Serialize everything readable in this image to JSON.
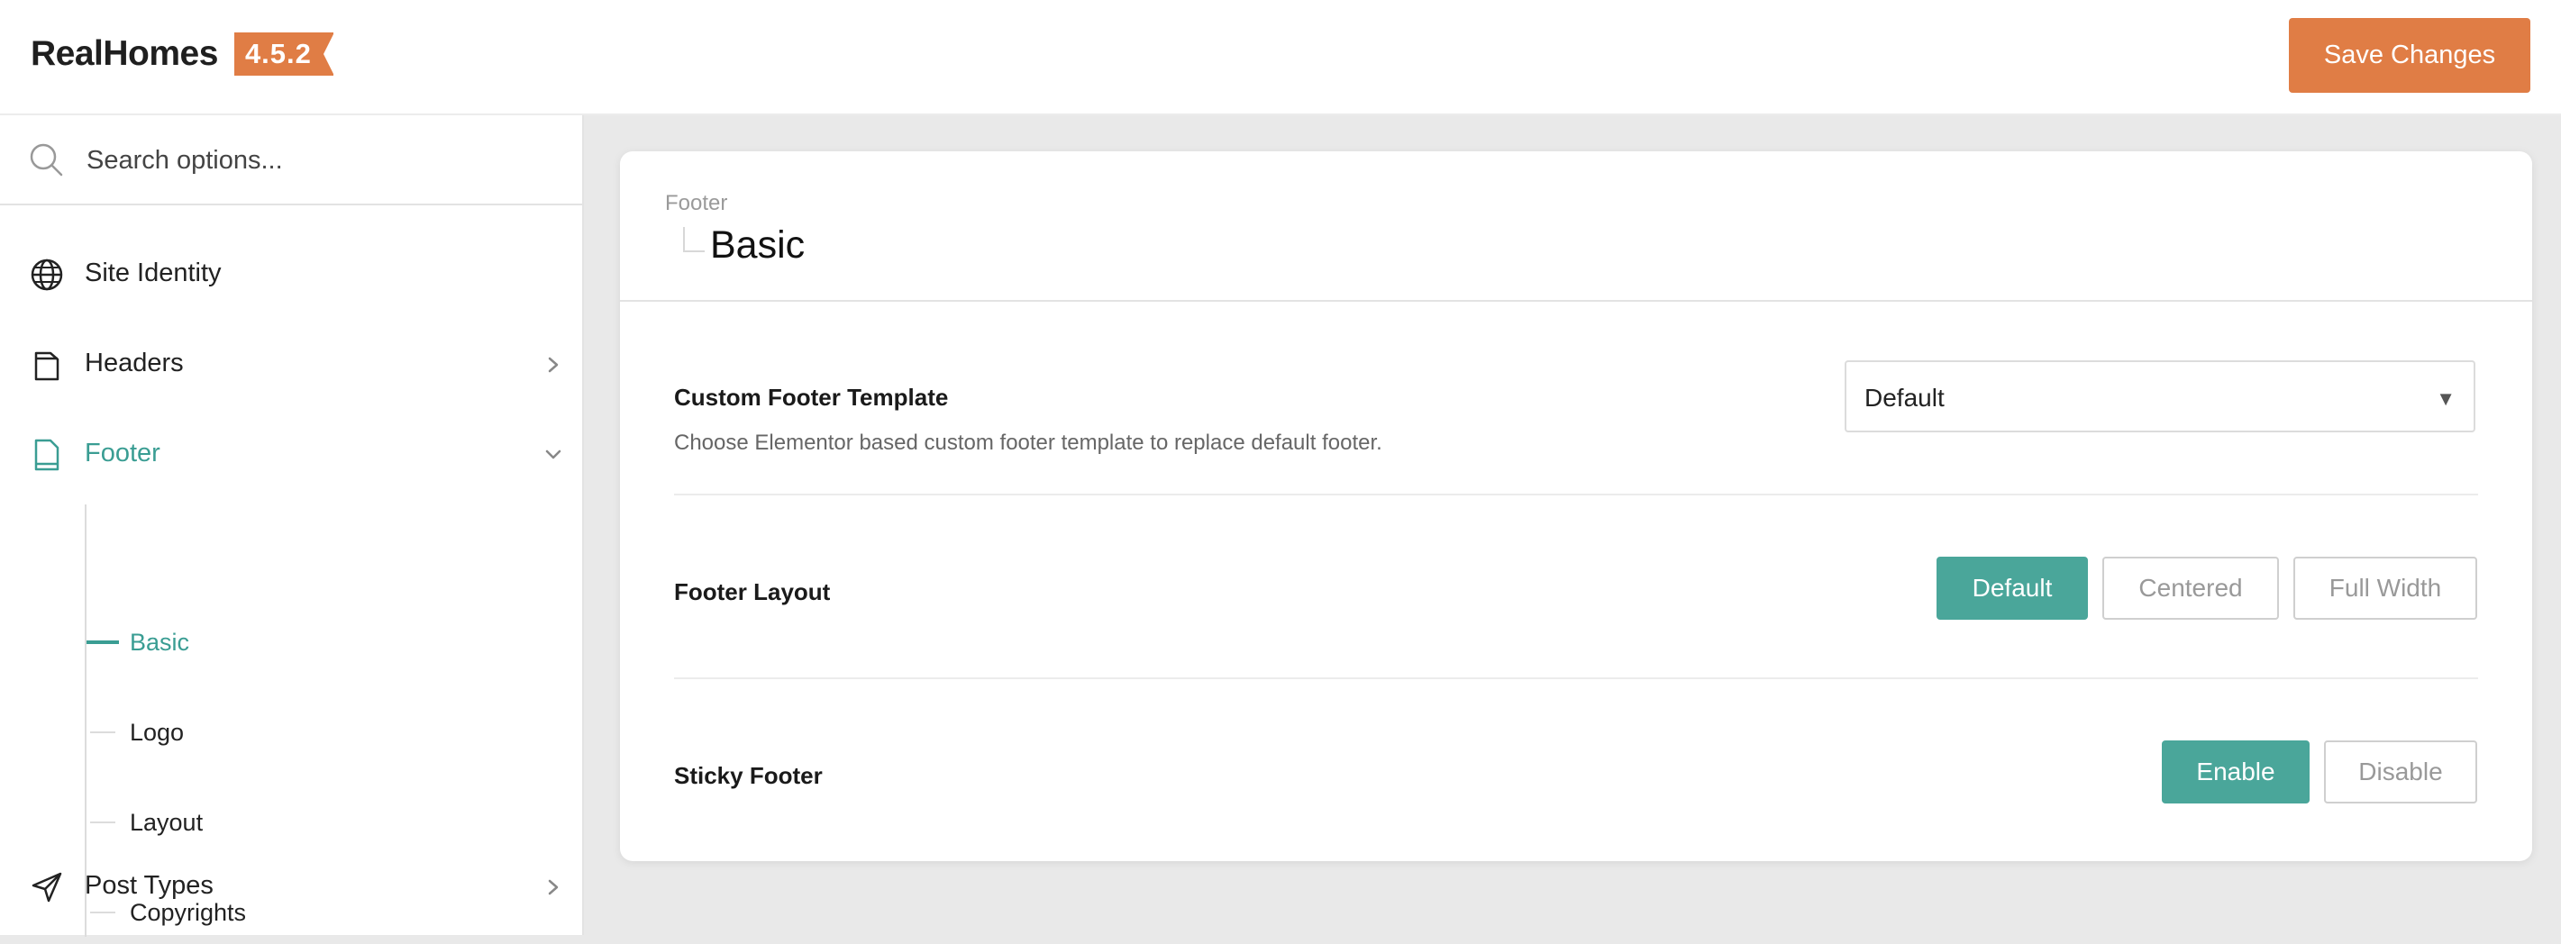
{
  "app": {
    "name": "RealHomes",
    "version": "4.5.2"
  },
  "toolbar": {
    "save_label": "Save Changes"
  },
  "search": {
    "placeholder": "Search options..."
  },
  "sidebar": {
    "items": [
      {
        "label": "Site Identity",
        "icon": "globe-icon"
      },
      {
        "label": "Headers",
        "icon": "document-icon",
        "chevron": "chevron-right"
      },
      {
        "label": "Footer",
        "icon": "document-footer-icon",
        "chevron": "chevron-down",
        "active": true,
        "children": [
          {
            "label": "Basic",
            "active": true
          },
          {
            "label": "Logo"
          },
          {
            "label": "Layout"
          },
          {
            "label": "Copyrights"
          }
        ]
      },
      {
        "label": "Post Types",
        "icon": "send-icon",
        "chevron": "chevron-right"
      }
    ]
  },
  "main": {
    "breadcrumb_parent": "Footer",
    "title": "Basic",
    "settings": {
      "custom_footer_template": {
        "label": "Custom Footer Template",
        "description": "Choose Elementor based custom footer template to replace default footer.",
        "value": "Default"
      },
      "footer_layout": {
        "label": "Footer Layout",
        "options": [
          "Default",
          "Centered",
          "Full Width"
        ],
        "selected": "Default"
      },
      "sticky_footer": {
        "label": "Sticky Footer",
        "options": [
          "Enable",
          "Disable"
        ],
        "selected": "Enable"
      }
    }
  },
  "colors": {
    "accent": "#4aa69a",
    "active_text": "#3a9d93",
    "brand": "#e07d45"
  }
}
